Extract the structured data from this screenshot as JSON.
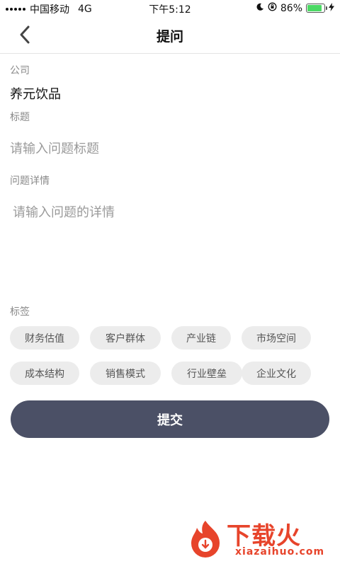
{
  "status_bar": {
    "carrier": "中国移动",
    "network": "4G",
    "time": "下午5:12",
    "battery_text": "86%",
    "battery_level": 0.86,
    "battery_color": "#4cd964"
  },
  "nav": {
    "title": "提问",
    "back_icon": "chevron-left-icon"
  },
  "form": {
    "company_label": "公司",
    "company_value": "养元饮品",
    "title_label": "标题",
    "title_placeholder": "请输入问题标题",
    "title_value": "",
    "details_label": "问题详情",
    "details_placeholder": "请输入问题的详情",
    "details_value": "",
    "tags_label": "标签",
    "tags": [
      "财务估值",
      "客户群体",
      "产业链",
      "市场空间",
      "成本结构",
      "销售模式",
      "行业壁垒",
      "企业文化"
    ]
  },
  "submit_label": "提交",
  "accent_color": "#4b5066",
  "watermark": {
    "text": "下载火",
    "url": "xiazaihuo.com"
  }
}
